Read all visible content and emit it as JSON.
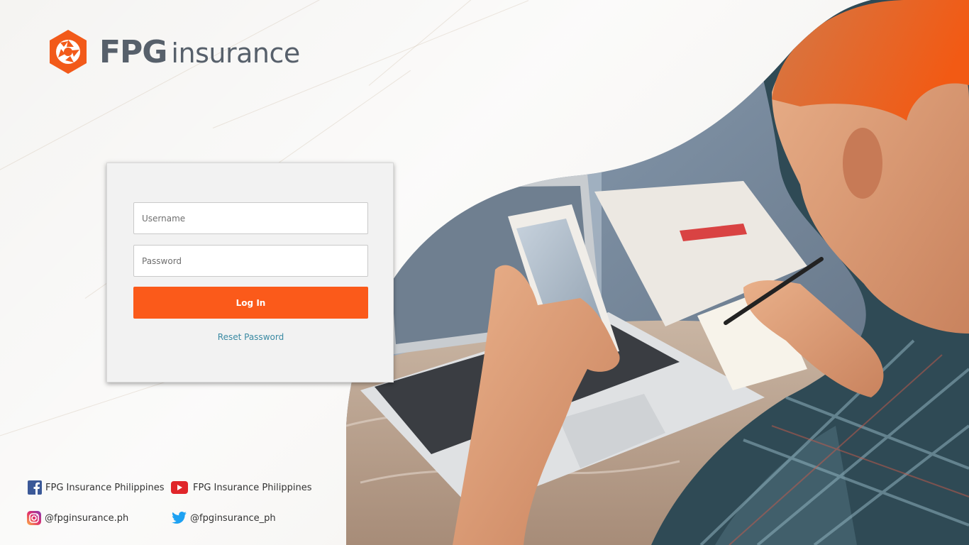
{
  "brand": {
    "logo_primary": "FPG",
    "logo_secondary": "insurance",
    "logo_color": "#57606b",
    "accent_color": "#fb5a1a"
  },
  "login": {
    "username_placeholder": "Username",
    "username_value": "",
    "password_placeholder": "Password",
    "password_value": "",
    "login_button_label": "Log In",
    "reset_password_label": "Reset Password"
  },
  "social": {
    "facebook": {
      "label": "FPG Insurance Philippines",
      "icon": "facebook-icon"
    },
    "youtube": {
      "label": "FPG Insurance Philippines",
      "icon": "youtube-icon"
    },
    "instagram": {
      "label": "@fpginsurance.ph",
      "icon": "instagram-icon"
    },
    "twitter": {
      "label": "@fpginsurance_ph",
      "icon": "twitter-icon"
    }
  },
  "hero": {
    "subject": "person using smartphone beside laptop and notebook"
  }
}
